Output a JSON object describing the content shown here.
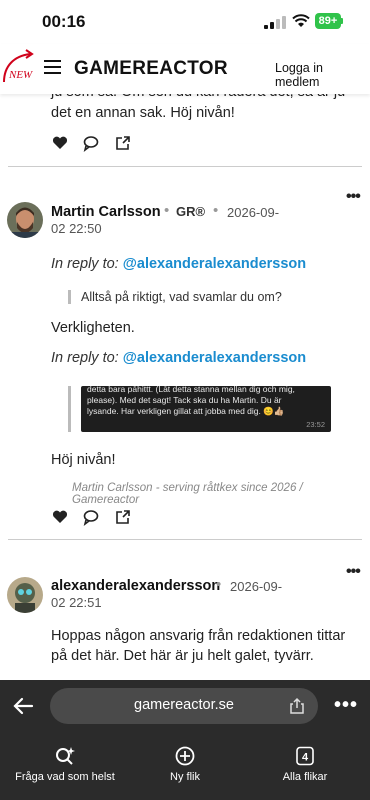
{
  "status": {
    "time": "00:16",
    "battery": "89+"
  },
  "header": {
    "new_badge": "NEW",
    "logo": "GAMEREACTOR",
    "login": "Logga in medlem"
  },
  "prev_comment": {
    "text": "ju som så. Om sen du kan radera det, så är ju det en annan sak. Höj nivån!"
  },
  "comment1": {
    "author": "Martin Carlsson",
    "badge": "GR®",
    "date_line1": "2026-09-",
    "date_line2": "02 22:50",
    "reply_prefix": "In reply to:",
    "reply1_handle": "@alexanderalexandersson",
    "quote1": "Alltså på riktigt, vad svamlar du om?",
    "text1": "Verkligheten.",
    "reply2_handle": "@alexanderalexandersson",
    "chat_text": "detta bara påhittt. (Låt detta stanna mellan dig och mig, please). Med det sagt! Tack ska du ha Martin. Du är lysande. Har verkligen gillat att jobba med dig. 😊👍🏼",
    "chat_time": "23:52",
    "text2": "Höj nivån!",
    "signature": "Martin Carlsson - serving råttkex since 2026 / Gamereactor"
  },
  "comment2": {
    "author": "alexanderalexandersson",
    "date_line1": "2026-09-",
    "date_line2": "02 22:51",
    "text": "Hoppas någon ansvarig från redaktionen tittar på det här. Det här är ju helt galet, tyvärr."
  },
  "browser": {
    "url": "gamereactor.se",
    "tab_count": "4",
    "items": [
      {
        "label": "Fråga vad som helst",
        "icon": "search-sparkle-icon"
      },
      {
        "label": "Ny flik",
        "icon": "plus-circle-icon"
      },
      {
        "label": "Alla flikar",
        "icon": "tabs-icon"
      }
    ]
  },
  "colors": {
    "link": "#1a8ccf",
    "battery": "#30c34a",
    "browser_bg": "#2b2b2b",
    "new_red": "#d0021b"
  }
}
